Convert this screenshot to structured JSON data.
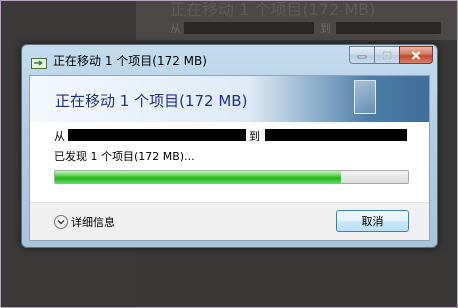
{
  "background_window": {
    "title": "正在移动 1 个项目(172 MB)",
    "from_label": "从",
    "to_label": "到"
  },
  "dialog": {
    "title": "正在移动 1 个项目(172 MB)",
    "header": "正在移动 1 个项目(172 MB)",
    "from_label": "从",
    "to_label": "到",
    "status": "已发现 1 个项目(172 MB)...",
    "progress_fraction": 0.81,
    "details_label": "详细信息",
    "cancel_label": "取消",
    "window_buttons": {
      "minimize_icon": "minimize-icon",
      "maximize_icon": "maximize-icon",
      "close_icon": "close-icon"
    }
  },
  "colors": {
    "header_text": "#1e3287",
    "progress": "#1fb61f",
    "close_button": "#c24a2b",
    "frame": "#b8a2c4"
  }
}
